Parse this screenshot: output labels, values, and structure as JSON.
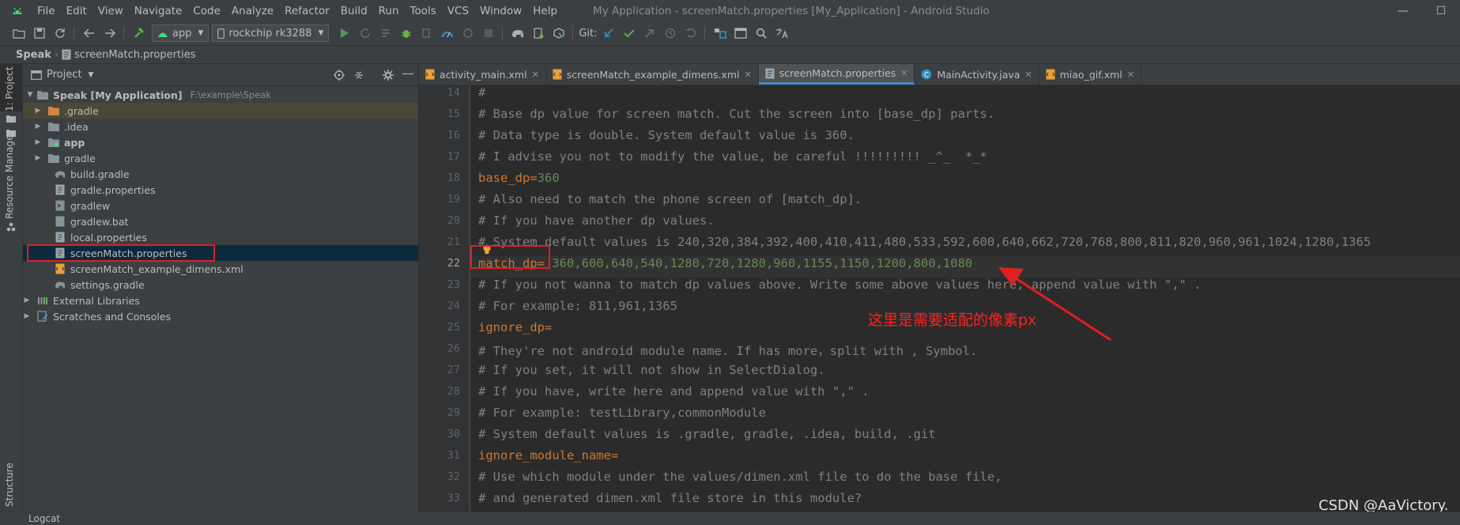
{
  "window": {
    "title": "My Application - screenMatch.properties [My_Application] - Android Studio",
    "menu": [
      "File",
      "Edit",
      "View",
      "Navigate",
      "Code",
      "Analyze",
      "Refactor",
      "Build",
      "Run",
      "Tools",
      "VCS",
      "Window",
      "Help"
    ],
    "minimize_glyph": "—",
    "maximize_glyph": "☐"
  },
  "toolbar": {
    "run_config": "app",
    "device": "rockchip rk3288",
    "git_label": "Git:"
  },
  "breadcrumb": {
    "root": "Speak",
    "file": "screenMatch.properties"
  },
  "left_stripe": {
    "project_tab": "1: Project",
    "resource_manager_tab": "Resource Manager",
    "structure_tab": "Structure"
  },
  "project_panel": {
    "title": "Project",
    "root_label": "Speak [My Application]",
    "root_name": "Speak",
    "root_module": "[My Application]",
    "root_path": "F:\\example\\Speak",
    "items": [
      {
        "label": ".gradle",
        "kind": "folder-orange"
      },
      {
        "label": ".idea",
        "kind": "folder"
      },
      {
        "label": "app",
        "kind": "folder-module"
      },
      {
        "label": "gradle",
        "kind": "folder"
      },
      {
        "label": "build.gradle",
        "kind": "gradle"
      },
      {
        "label": "gradle.properties",
        "kind": "properties"
      },
      {
        "label": "gradlew",
        "kind": "script"
      },
      {
        "label": "gradlew.bat",
        "kind": "file"
      },
      {
        "label": "local.properties",
        "kind": "properties"
      },
      {
        "label": "screenMatch.properties",
        "kind": "properties"
      },
      {
        "label": "screenMatch_example_dimens.xml",
        "kind": "xml"
      },
      {
        "label": "settings.gradle",
        "kind": "gradle"
      }
    ],
    "external_libraries": "External Libraries",
    "scratches": "Scratches and Consoles"
  },
  "editor_tabs": [
    {
      "label": "activity_main.xml",
      "icon": "xml-icon",
      "active": false
    },
    {
      "label": "screenMatch_example_dimens.xml",
      "icon": "xml-icon",
      "active": false
    },
    {
      "label": "screenMatch.properties",
      "icon": "properties-icon",
      "active": true
    },
    {
      "label": "MainActivity.java",
      "icon": "java-class-icon",
      "active": false
    },
    {
      "label": "miao_gif.xml",
      "icon": "xml-icon",
      "active": false
    }
  ],
  "editor": {
    "current_line": 22,
    "lines": [
      {
        "n": "14",
        "comment": "#"
      },
      {
        "n": "15",
        "comment": "# Base dp value for screen match. Cut the screen into [base_dp] parts."
      },
      {
        "n": "16",
        "comment": "# Data type is double. System default value is 360."
      },
      {
        "n": "17",
        "comment": "# I advise you not to modify the value, be careful !!!!!!!!! _^_  *_*"
      },
      {
        "n": "18",
        "key": "base_dp",
        "value": "360"
      },
      {
        "n": "19",
        "comment": "# Also need to match the phone screen of [match_dp]."
      },
      {
        "n": "20",
        "comment": "# If you have another dp values."
      },
      {
        "n": "21",
        "comment": "# System default values is 240,320,384,392,400,410,411,480,533,592,600,640,662,720,768,800,811,820,960,961,1024,1280,1365"
      },
      {
        "n": "22",
        "key": "match_dp",
        "value": " 360,600,640,540,1280,720,1280,960,1155,1150,1200,800,1080"
      },
      {
        "n": "23",
        "comment": "# If you not wanna to match dp values above. Write some above values here, append value with \",\" ."
      },
      {
        "n": "24",
        "comment": "# For example: 811,961,1365"
      },
      {
        "n": "25",
        "key": "ignore_dp",
        "value": ""
      },
      {
        "n": "26",
        "comment": "# They're not android module name. If has more，split with , Symbol."
      },
      {
        "n": "27",
        "comment": "# If you set, it will not show in SelectDialog."
      },
      {
        "n": "28",
        "comment": "# If you have, write here and append value with \",\" ."
      },
      {
        "n": "29",
        "comment": "# For example: testLibrary,commonModule"
      },
      {
        "n": "30",
        "comment": "# System default values is .gradle, gradle, .idea, build, .git"
      },
      {
        "n": "31",
        "key": "ignore_module_name",
        "value": ""
      },
      {
        "n": "32",
        "comment": "# Use which module under the values/dimen.xml file to do the base file,"
      },
      {
        "n": "33",
        "comment": "# and generated dimen.xml file store in this module?"
      }
    ]
  },
  "annotation": {
    "text": "这里是需要适配的像素px",
    "color": "#ff2020"
  },
  "watermark": "CSDN @AaVictory.",
  "bottom_bar": {
    "logcat": "Logcat"
  },
  "colors": {
    "comment": "#808080",
    "key": "#cc7832",
    "value": "#6a8759",
    "selection": "#0d293e",
    "accent": "#4a88c7"
  }
}
